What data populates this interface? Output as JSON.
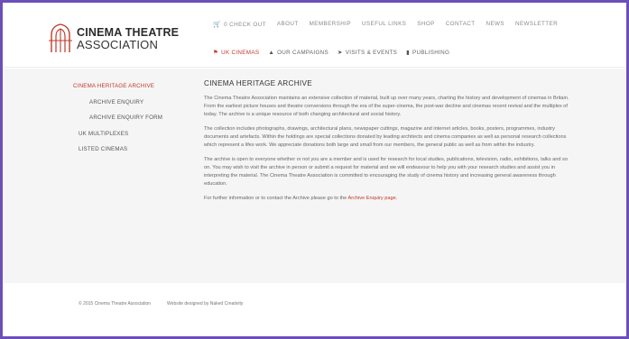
{
  "brand": {
    "line1": "CINEMA THEATRE",
    "line2": "ASSOCIATION",
    "logo_icon": "cta-logo-icon"
  },
  "topnav": [
    {
      "label": "0  CHECK OUT",
      "icon": "cart-icon"
    },
    {
      "label": "ABOUT"
    },
    {
      "label": "MEMBERSHIP"
    },
    {
      "label": "USEFUL LINKS"
    },
    {
      "label": "SHOP"
    },
    {
      "label": "CONTACT"
    },
    {
      "label": "NEWS"
    },
    {
      "label": "NEWSLETTER"
    }
  ],
  "subnav": [
    {
      "label": "UK CINEMAS",
      "icon": "flag-icon",
      "active": true
    },
    {
      "label": "OUR CAMPAIGNS",
      "icon": "megaphone-icon"
    },
    {
      "label": "VISITS & EVENTS",
      "icon": "pin-icon"
    },
    {
      "label": "PUBLISHING",
      "icon": "book-icon"
    }
  ],
  "sidebar": [
    {
      "label": "CINEMA HERITAGE ARCHIVE",
      "active": true
    },
    {
      "label": "ARCHIVE ENQUIRY"
    },
    {
      "label": "ARCHIVE ENQUIRY FORM"
    },
    {
      "label": "UK MULTIPLEXES"
    },
    {
      "label": "LISTED CINEMAS"
    }
  ],
  "main": {
    "title": "CINEMA HERITAGE ARCHIVE",
    "paragraphs": [
      "The Cinema Theatre Association maintains an extensive collection of material, built up over many years, charting the history and development of cinemas in Britain. From the earliest picture houses and theatre conversions through the era of the super-cinema, the post-war decline and cinemas recent revival and the multiplex of today. The archive is a unique resource of both changing architectural and social history.",
      "The collection includes photographs, drawings, architectural plans, newspaper cuttings, magazine and internet articles, books, posters, programmes, industry documents and artefacts. Within the holdings are special collections donated by leading architects and cinema companies as well as personal research collections which represent a lifes work. We appreciate donations both large and small from our members, the general public as well as from within the industry.",
      "The archive is open to everyone whether or not you are a member and is used for research for local studies, publications, television, radio, exhibitions, talks and so on. You may wish to visit the archive in person or submit a request for material and we will endeavour to help you with your research studies and assist you in interpreting the material. The Cinema Theatre Association is committed to encouraging the study of cinema history and increasing general awareness through education."
    ],
    "contact_prefix": "For further information or to contact the Archive please go to the ",
    "contact_link": "Archive Enquiry page",
    "contact_suffix": "."
  },
  "footer": {
    "copyright": "© 2015 Cinema Theatre Association",
    "credit": "Website designed by Naked Creativity"
  },
  "colors": {
    "accent": "#c0392b",
    "frame": "#6c4fb8",
    "band": "#f5f5f5"
  }
}
